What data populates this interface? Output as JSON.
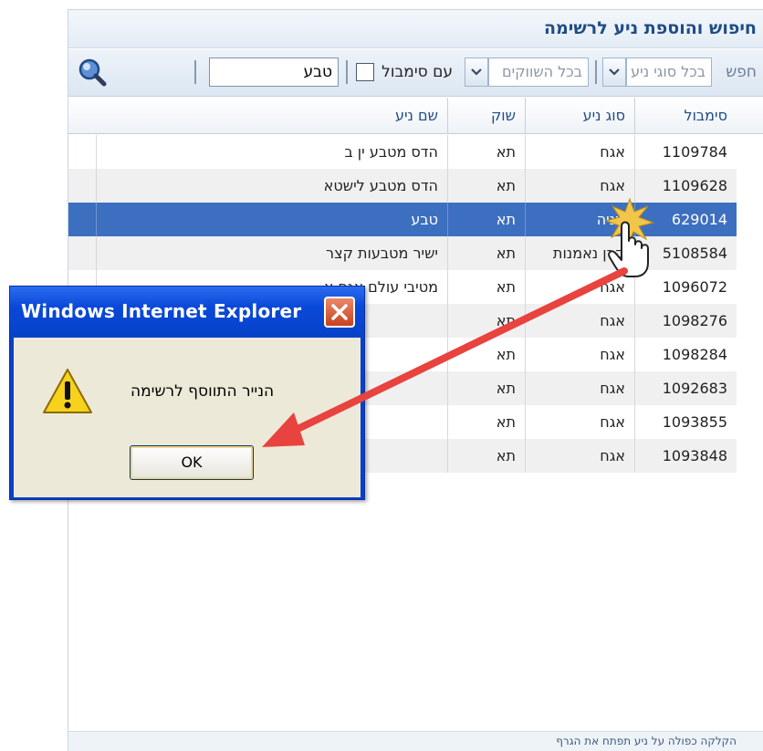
{
  "panel": {
    "title": "חיפוש והוספת ניע לרשימה"
  },
  "toolbar": {
    "search_label": "חפש",
    "security_type_combo": "בכל סוגי ניע",
    "market_combo": "בכל השווקים",
    "with_symbol_label": "עם סימבול",
    "search_value": "טבע",
    "search_icon": "magnifier-icon"
  },
  "grid": {
    "columns": [
      "סימבול",
      "סוג ניע",
      "שוק",
      "שם ניע"
    ],
    "rows": [
      [
        "1109784",
        "אגח",
        "תא",
        "הדס מטבע ין ב"
      ],
      [
        "1109628",
        "אגח",
        "תא",
        "הדס מטבע לישטא"
      ],
      [
        "629014",
        "מניה",
        "תא",
        "טבע"
      ],
      [
        "5108584",
        "קרן נאמנות",
        "תא",
        "ישיר מטבעות קצר"
      ],
      [
        "1096072",
        "אגח",
        "תא",
        "מטיבי עולם אגח א"
      ],
      [
        "1098276",
        "אגח",
        "תא",
        ""
      ],
      [
        "1098284",
        "אגח",
        "תא",
        ""
      ],
      [
        "1092683",
        "אגח",
        "תא",
        ""
      ],
      [
        "1093855",
        "אגח",
        "תא",
        ""
      ],
      [
        "1093848",
        "אגח",
        "תא",
        ""
      ]
    ],
    "selected_row": 2
  },
  "footer": {
    "hint": "הקלקה כפולה על ניע תפתח את הגרף"
  },
  "dialog": {
    "title": "Windows Internet Explorer",
    "message": "הנייר התווסף לרשימה",
    "ok_label": "OK",
    "icon": "warning-icon"
  },
  "colors": {
    "selected_row": "#3d6fc0",
    "title_text": "#1f4c86",
    "dialog_title": "#0a48d8",
    "arrow": "#e8433f"
  }
}
